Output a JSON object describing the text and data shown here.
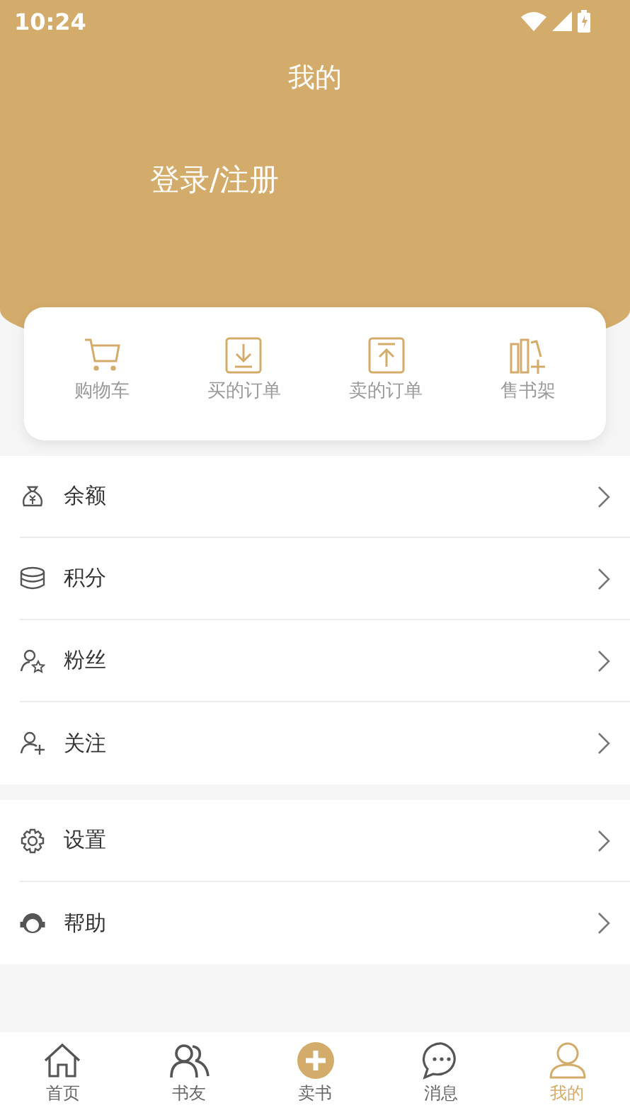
{
  "status_bar": {
    "time": "10:24"
  },
  "header": {
    "title": "我的",
    "login": "登录/注册"
  },
  "shortcuts": [
    {
      "label": "购物车"
    },
    {
      "label": "买的订单"
    },
    {
      "label": "卖的订单"
    },
    {
      "label": "售书架"
    }
  ],
  "menu_groups": [
    [
      {
        "label": "余额"
      },
      {
        "label": "积分"
      },
      {
        "label": "粉丝"
      },
      {
        "label": "关注"
      }
    ],
    [
      {
        "label": "设置"
      },
      {
        "label": "帮助"
      }
    ]
  ],
  "bottom_nav": [
    {
      "label": "首页",
      "selected": false,
      "kind": "tab"
    },
    {
      "label": "书友",
      "selected": false,
      "kind": "tab"
    },
    {
      "label": "卖书",
      "selected": false,
      "kind": "action"
    },
    {
      "label": "消息",
      "selected": false,
      "kind": "tab"
    },
    {
      "label": "我的",
      "selected": true,
      "kind": "tab"
    }
  ]
}
